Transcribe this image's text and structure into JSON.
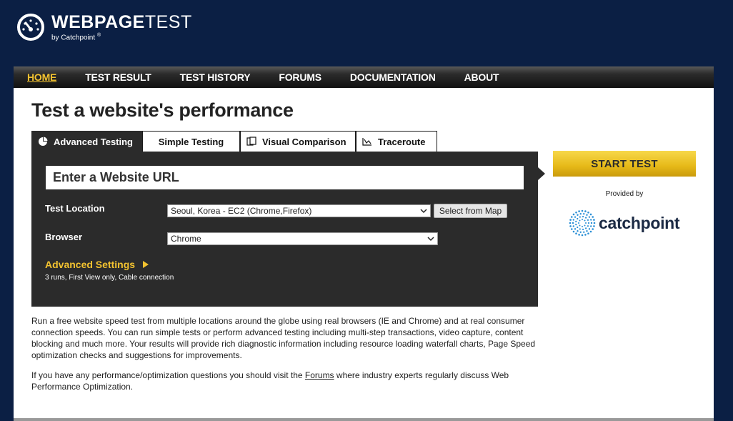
{
  "header": {
    "logo_bold": "WEBPAGE",
    "logo_light": "TEST",
    "logo_by": "by Catchpoint",
    "logo_reg": "®",
    "gauge_icon": "speedometer-icon"
  },
  "nav": {
    "items": [
      {
        "label": "HOME",
        "active": true
      },
      {
        "label": "TEST RESULT",
        "active": false
      },
      {
        "label": "TEST HISTORY",
        "active": false
      },
      {
        "label": "FORUMS",
        "active": false
      },
      {
        "label": "DOCUMENTATION",
        "active": false
      },
      {
        "label": "ABOUT",
        "active": false
      }
    ]
  },
  "page": {
    "title": "Test a website's performance"
  },
  "tabs": [
    {
      "label": "Advanced Testing",
      "icon": "pie-chart-icon",
      "active": true
    },
    {
      "label": "Simple Testing",
      "icon": "",
      "active": false
    },
    {
      "label": "Visual Comparison",
      "icon": "compare-icon",
      "active": false
    },
    {
      "label": "Traceroute",
      "icon": "traceroute-icon",
      "active": false
    }
  ],
  "form": {
    "url_placeholder": "Enter a Website URL",
    "location_label": "Test Location",
    "location_value": "Seoul, Korea - EC2 (Chrome,Firefox)",
    "map_button": "Select from Map",
    "browser_label": "Browser",
    "browser_value": "Chrome",
    "advanced_label": "Advanced Settings",
    "advanced_summary": "3 runs, First View only, Cable connection"
  },
  "sidebar": {
    "start_button": "START TEST",
    "provided_by": "Provided by",
    "sponsor": "catchpoint"
  },
  "description": {
    "para1": "Run a free website speed test from multiple locations around the globe using real browsers (IE and Chrome) and at real consumer connection speeds. You can run simple tests or perform advanced testing including multi-step transactions, video capture, content blocking and much more. Your results will provide rich diagnostic information including resource loading waterfall charts, Page Speed optimization checks and suggestions for improvements.",
    "para2_before": "If you have any performance/optimization questions you should visit the ",
    "para2_link": "Forums",
    "para2_after": " where industry experts regularly discuss Web Performance Optimization."
  },
  "colors": {
    "background": "#0b1f44",
    "accent": "#f2c230",
    "panel": "#2b2b2b"
  }
}
